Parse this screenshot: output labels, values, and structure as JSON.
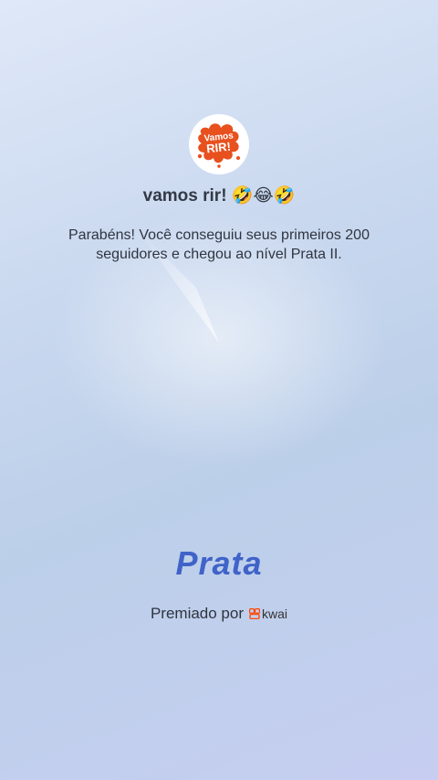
{
  "profile": {
    "avatar_logo_line1": "Vamos",
    "avatar_logo_line2": "RIR!",
    "username": "vamos rir! 🤣😂🤣"
  },
  "achievement": {
    "message": "Parabéns! Você conseguiu seus primeiros 200 seguidores e chegou ao nível Prata II.",
    "level_name": "Prata"
  },
  "footer": {
    "awarded_by_label": "Premiado por",
    "brand_name": "kwai",
    "brand_icon": "kwai-logo-icon"
  },
  "colors": {
    "level_text": "#3f63c8",
    "avatar_splash": "#e8501e",
    "brand_icon": "#ff4906"
  }
}
